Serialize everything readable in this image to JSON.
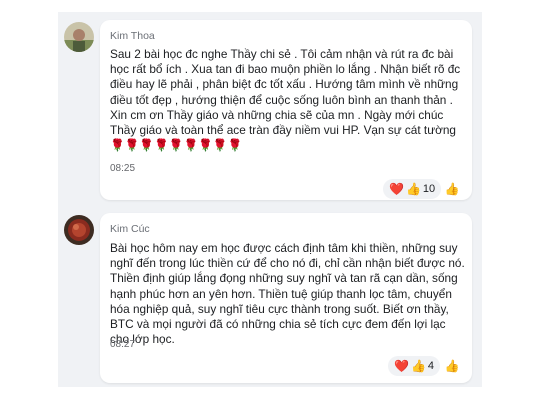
{
  "comments": [
    {
      "author": "Kim Thoa",
      "text": "Sau 2 bài học đc nghe Thầy chi sẻ . Tôi cảm nhận và rút ra đc bài học rất bổ ích . Xua tan đi bao muộn phiền lo lắng . Nhận biết rõ đc điều hay lẽ phải , phân biệt đc tốt xấu . Hướng tâm mình về những điều tốt đẹp , hướng thiện để cuộc sống luôn bình an thanh thản . Xin cm ơn Thầy giáo và những chia sẽ của mn . Ngày mới chúc Thầy giáo và toàn thể ace tràn đầy niềm vui HP. Vạn sự cát tường ",
      "roses": "🌹🌹🌹🌹🌹🌹🌹🌹🌹",
      "time": "08:25",
      "reaction_icons": [
        "heart-emoji",
        "thumbs-up-emoji"
      ],
      "reaction_count": "10"
    },
    {
      "author": "Kim Cúc",
      "text": "Bài học hôm nay em học được cách định tâm khi thiền, những suy nghĩ đến trong lúc thiền cứ để cho nó đi, chỉ cần nhận biết được nó. Thiền định giúp lắng đọng những suy nghĩ và tan rã cạn dần, sống hạnh phúc hơn an yên hơn. Thiền tuệ giúp thanh lọc tâm, chuyển hóa nghiệp quả, suy nghĩ tiêu cực thành trong suốt. Biết ơn thầy, BTC và mọi người đã có những chia sẻ tích cực đem đến lợi lạc cho lớp học.",
      "time": "08:27",
      "reaction_icons": [
        "heart-emoji",
        "thumbs-up-emoji"
      ],
      "reaction_count": "4"
    }
  ],
  "colors": {
    "feed_bg": "#f0f2f5",
    "card_bg": "#ffffff",
    "name_text": "#6b6f76",
    "body_text": "#1c1e21",
    "reaction_blue": "#1877f2"
  },
  "icons": {
    "like_button": "thumbs-up-icon"
  }
}
